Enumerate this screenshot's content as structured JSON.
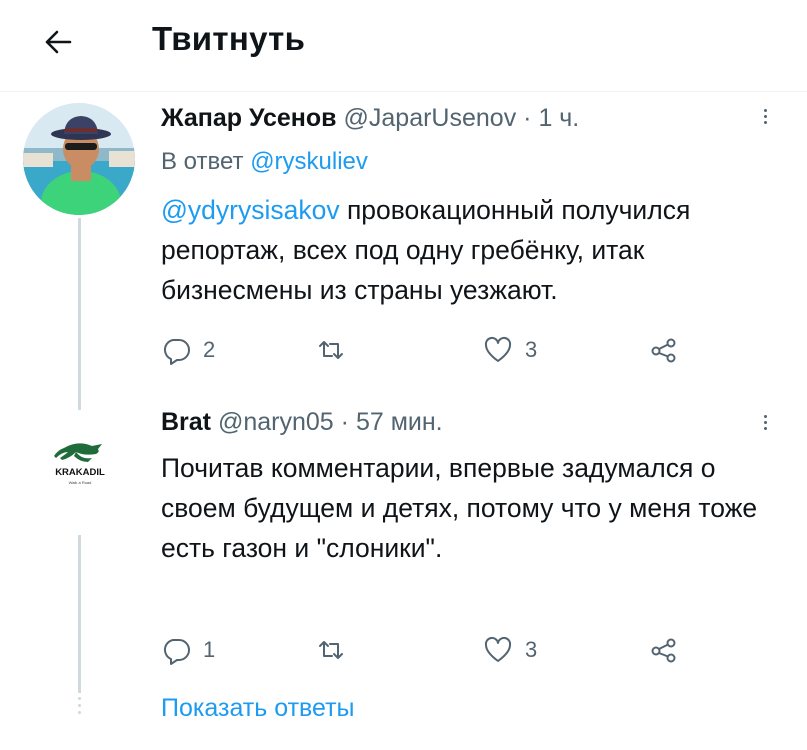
{
  "header": {
    "title": "Твитнуть",
    "back_icon": "arrow-left-icon"
  },
  "tweets": [
    {
      "name": "Жапар Усенов",
      "handle": "@JaparUsenov",
      "separator": "·",
      "time": "1 ч.",
      "reply_prefix": "В ответ ",
      "reply_to": "@ryskuliev",
      "mention": "@ydyrysisakov",
      "text": " провокационный получился репортаж, всех под одну гребёнку, итак бизнесмены из страны уезжают.",
      "replies": "2",
      "retweets": "",
      "likes": "3"
    },
    {
      "name": "Brat",
      "handle": "@naryn05",
      "separator": "·",
      "time": "57 мин.",
      "avatar_text": "KRAKADIL",
      "avatar_subtext": "Walk a Road",
      "text": "Почитав комментарии, впервые задумался о своем будущем и детях, потому что у меня тоже есть газон и \"слоники\".",
      "replies": "1",
      "retweets": "",
      "likes": "3"
    }
  ],
  "show_replies": "Показать ответы",
  "colors": {
    "accent": "#1d9bf0",
    "secondary_text": "#536471",
    "primary_text": "#0f1419",
    "thread_line": "#cfd9de"
  }
}
